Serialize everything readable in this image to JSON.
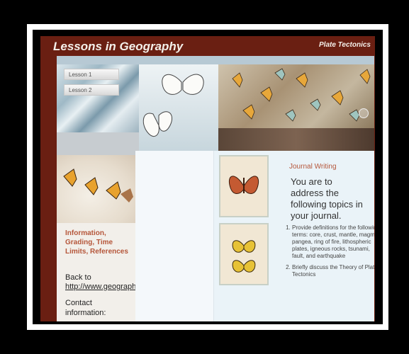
{
  "site": {
    "title": "Lessons in Geography",
    "subtitle": "Plate Tectonics"
  },
  "nav": {
    "items": [
      {
        "label": "Lesson 1"
      },
      {
        "label": "Lesson 2"
      }
    ]
  },
  "sidebar": {
    "info_link": "Information, Grading, Time Limits, References",
    "back_text": "Back to",
    "back_url": "http://www.geography.isranic.com/",
    "contact_text": "Contact information:"
  },
  "journal": {
    "title": "Journal Writing",
    "intro": "You are to address the following topics in your journal.",
    "topics": [
      "Provide definitions for the following terms: core, crust, mantle, magma, pangea, ring of fire, lithospheric plates, igneous rocks, tsunami, fault, and earthquake",
      "Briefly discuss the Theory of Plate Tectonics"
    ]
  },
  "colors": {
    "frame": "#6a1f12",
    "accent": "#b5563a"
  }
}
